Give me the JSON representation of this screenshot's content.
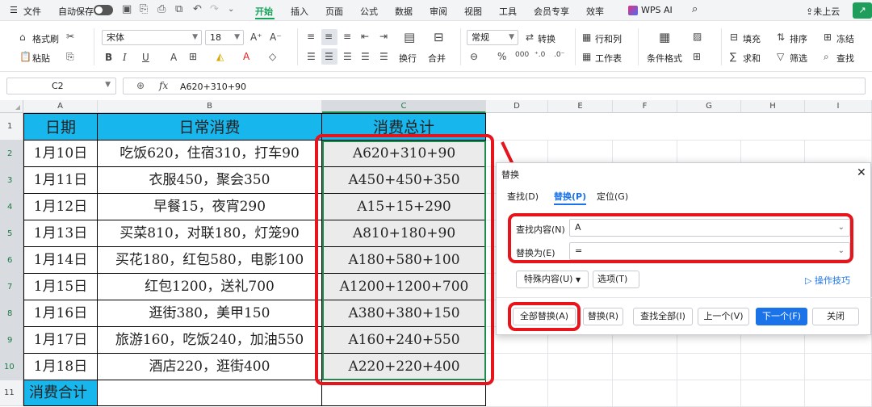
{
  "menubar": {
    "hamburger": "☰",
    "file": "文件",
    "autosave": "自动保存",
    "tabs": [
      "开始",
      "插入",
      "页面",
      "公式",
      "数据",
      "审阅",
      "视图",
      "工具",
      "会员专享",
      "效率"
    ],
    "wps_ai": "WPS AI",
    "cloud": "未上云",
    "active_color": "#17a35b"
  },
  "ribbon": {
    "format_painter": "格式刷",
    "paste": "粘贴",
    "font_name": "宋体",
    "font_size": "18",
    "number_format": "常规",
    "convert": "转换",
    "row_col": "行和列",
    "worksheet": "工作表",
    "wrap": "换行",
    "merge": "合并",
    "cond_format": "条件格式",
    "fill": "填充",
    "sort": "排序",
    "freeze": "冻结",
    "sum": "求和",
    "filter": "筛选",
    "find": "查找"
  },
  "formula_bar": {
    "cell_ref": "C2",
    "fx": "fx",
    "formula": "A620+310+90"
  },
  "columns": [
    "A",
    "B",
    "C",
    "D",
    "E",
    "F",
    "G",
    "H",
    "I"
  ],
  "rows": [
    "1",
    "2",
    "3",
    "4",
    "5",
    "6",
    "7",
    "8",
    "9",
    "10",
    "11"
  ],
  "table": {
    "header": [
      "日期",
      "日常消费",
      "消费总计"
    ],
    "rows": [
      [
        "1月10日",
        "吃饭620，住宿310，打车90",
        "A620+310+90"
      ],
      [
        "1月11日",
        "衣服450，聚会350",
        "A450+450+350"
      ],
      [
        "1月12日",
        "早餐15，夜宵290",
        "A15+15+290"
      ],
      [
        "1月13日",
        "买菜810，对联180，灯笼90",
        "A810+180+90"
      ],
      [
        "1月14日",
        "买花180，红包580，电影100",
        "A180+580+100"
      ],
      [
        "1月15日",
        "红包1200，送礼700",
        "A1200+1200+700"
      ],
      [
        "1月16日",
        "逛街380，美甲150",
        "A380+380+150"
      ],
      [
        "1月17日",
        "旅游160，吃饭240，加油550",
        "A160+240+550"
      ],
      [
        "1月18日",
        "酒店220，逛街400",
        "A220+220+400"
      ]
    ],
    "footer": "消费合计",
    "header_color": "#17b7ee"
  },
  "dialog": {
    "title": "替换",
    "tabs": [
      "查找(D)",
      "替换(P)",
      "定位(G)"
    ],
    "find_label": "查找内容(N)",
    "find_value": "A",
    "replace_label": "替换为(E)",
    "replace_value": "=",
    "special_btn": "特殊内容(U)",
    "options_btn": "选项(T)",
    "tips_link": "操作技巧",
    "buttons": [
      "全部替换(A)",
      "替换(R)",
      "查找全部(I)",
      "上一个(V)",
      "下一个(F)",
      "关闭"
    ],
    "accent": "#1a73e8",
    "highlight": "#e8141c"
  }
}
